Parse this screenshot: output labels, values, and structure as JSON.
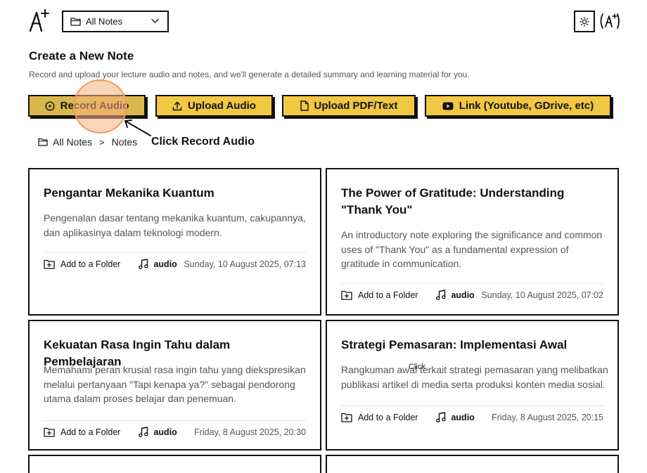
{
  "header": {
    "folder_select": {
      "value": "All Notes",
      "icon": "folder-icon"
    },
    "theme_icon": "sun-icon"
  },
  "create": {
    "title": "Create a New Note",
    "description": "Record and upload your lecture audio and notes, and we'll generate a detailed summary and learning material for you."
  },
  "actions": {
    "record": "Record Audio",
    "upload_audio": "Upload Audio",
    "upload_pdf": "Upload PDF/Text",
    "link": "Link (Youtube, GDrive, etc)"
  },
  "annotation": {
    "instruction": "Click Record Audio",
    "click_label": "Click"
  },
  "breadcrumb": {
    "root": "All Notes",
    "separator": ">",
    "current": "Notes"
  },
  "notes": [
    {
      "title": "Pengantar Mekanika Kuantum",
      "summary": "Pengenalan dasar tentang mekanika kuantum, cakupannya, dan aplikasinya dalam teknologi modern.",
      "add_folder": "Add to a Folder",
      "type": "audio",
      "date": "Sunday, 10 August 2025, 07:13"
    },
    {
      "title": "The Power of Gratitude: Understanding \"Thank You\"",
      "summary": "An introductory note exploring the significance and common uses of \"Thank You\" as a fundamental expression of gratitude in communication.",
      "add_folder": "Add to a Folder",
      "type": "audio",
      "date": "Sunday, 10 August 2025, 07:02"
    },
    {
      "title": "Kekuatan Rasa Ingin Tahu dalam Pembelajaran",
      "summary": "Memahami peran krusial rasa ingin tahu yang diekspresikan melalui pertanyaan \"Tapi kenapa ya?\" sebagai pendorong utama dalam proses belajar dan penemuan.",
      "add_folder": "Add to a Folder",
      "type": "audio",
      "date": "Friday, 8 August 2025, 20:30"
    },
    {
      "title": "Strategi Pemasaran: Implementasi Awal",
      "summary": "Rangkuman awal terkait strategi pemasaran yang melibatkan publikasi artikel di media serta produksi konten media sosial.",
      "add_folder": "Add to a Folder",
      "type": "audio",
      "date": "Friday, 8 August 2025, 20:15"
    }
  ],
  "colors": {
    "accent": "#f2c744",
    "accent_pressed": "#d9b74c",
    "border": "#111111",
    "muted_text": "#555555",
    "click_highlight": "#f8b282"
  }
}
